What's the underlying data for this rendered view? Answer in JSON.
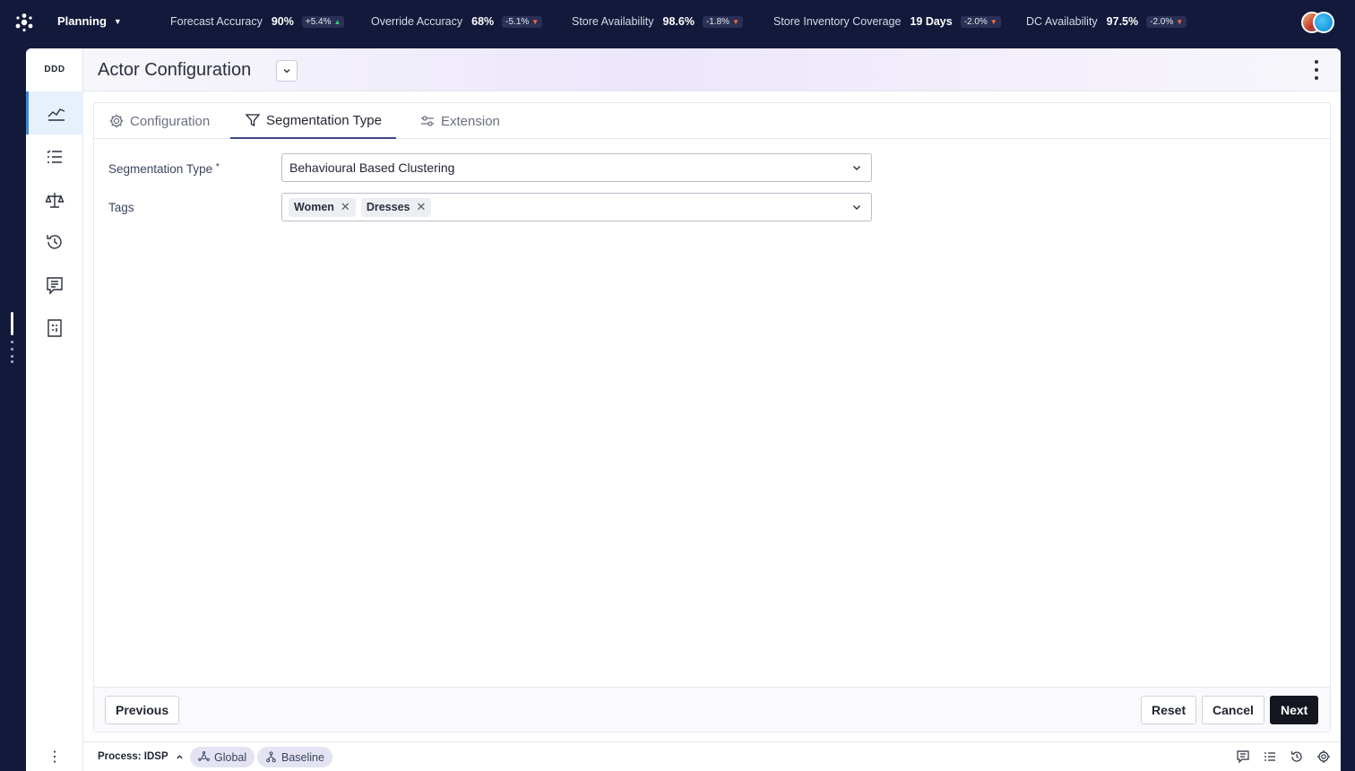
{
  "topbar": {
    "module": "Planning",
    "kpis": [
      {
        "label": "Forecast Accuracy",
        "value": "90%",
        "delta": "+5.4%",
        "trend": "up"
      },
      {
        "label": "Override Accuracy",
        "value": "68%",
        "delta": "-5.1%",
        "trend": "down"
      },
      {
        "label": "Store Availability",
        "value": "98.6%",
        "delta": "-1.8%",
        "trend": "down"
      },
      {
        "label": "Store Inventory Coverage",
        "value": "19 Days",
        "delta": "-2.0%",
        "trend": "down"
      },
      {
        "label": "DC Availability",
        "value": "97.5%",
        "delta": "-2.0%",
        "trend": "down"
      }
    ]
  },
  "sidebar": {
    "brand": "DDD",
    "items": [
      {
        "icon": "trend-chart-icon",
        "active": true
      },
      {
        "icon": "checklist-icon",
        "active": false
      },
      {
        "icon": "scale-icon",
        "active": false
      },
      {
        "icon": "history-icon",
        "active": false
      },
      {
        "icon": "comments-icon",
        "active": false
      },
      {
        "icon": "calculator-doc-icon",
        "active": false
      }
    ]
  },
  "header": {
    "title": "Actor Configuration"
  },
  "tabs": [
    {
      "label": "Configuration",
      "icon": "gear-icon",
      "active": false
    },
    {
      "label": "Segmentation Type",
      "icon": "filter-icon",
      "active": true
    },
    {
      "label": "Extension",
      "icon": "sliders-icon",
      "active": false
    }
  ],
  "form": {
    "segmentation_label": "Segmentation Type",
    "segmentation_required": "*",
    "segmentation_value": "Behavioural Based Clustering",
    "tags_label": "Tags",
    "tags": [
      "Women",
      "Dresses"
    ]
  },
  "footer": {
    "previous": "Previous",
    "reset": "Reset",
    "cancel": "Cancel",
    "next": "Next"
  },
  "statusbar": {
    "process": "Process: IDSP",
    "scope": "Global",
    "version": "Baseline"
  },
  "colors": {
    "topbar_bg": "#13193a",
    "active_nav": "#3b8ad9",
    "primary_button": "#14171f",
    "delta_up": "#2ecc71",
    "delta_down": "#ff6b3d"
  }
}
